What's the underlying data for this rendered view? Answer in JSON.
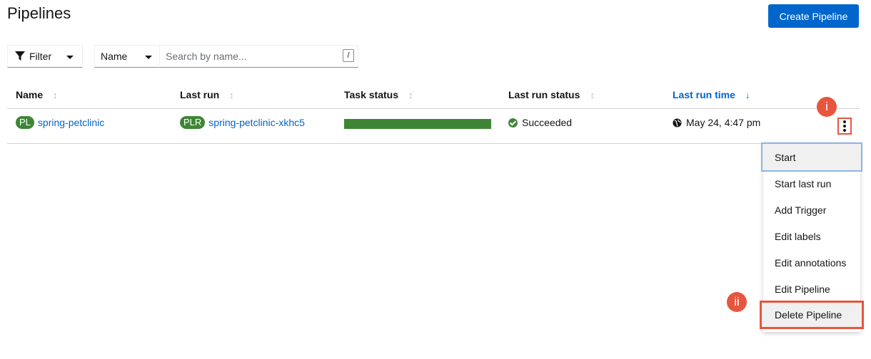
{
  "page": {
    "title": "Pipelines"
  },
  "header": {
    "create_label": "Create Pipeline"
  },
  "toolbar": {
    "filter_label": "Filter",
    "name_select": "Name",
    "search_placeholder": "Search by name...",
    "shortcut_hint": "/"
  },
  "table": {
    "columns": [
      "Name",
      "Last run",
      "Task status",
      "Last run status",
      "Last run time"
    ],
    "sorted_column": "Last run time",
    "rows": [
      {
        "name_badge": "PL",
        "name": "spring-petclinic",
        "lastrun_badge": "PLR",
        "last_run": "spring-petclinic-xkhc5",
        "task_status_fraction": 1.0,
        "status": "Succeeded",
        "time": "May 24, 4:47 pm"
      }
    ]
  },
  "callouts": {
    "first": "i",
    "second": "ii"
  },
  "menu": {
    "items": [
      "Start",
      "Start last run",
      "Add Trigger",
      "Edit labels",
      "Edit annotations",
      "Edit Pipeline",
      "Delete Pipeline"
    ]
  },
  "colors": {
    "primary": "#0066cc",
    "success": "#3e8635",
    "callout": "#e8553e"
  }
}
